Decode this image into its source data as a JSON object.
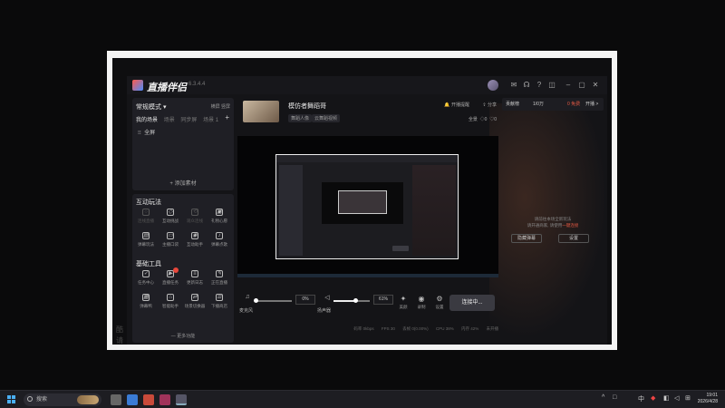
{
  "app": {
    "title": "直播伴侣",
    "version": "6.3.4.4"
  },
  "titlebar_icons": [
    "message-icon",
    "headset-icon",
    "help-icon",
    "skin-icon",
    "minimize-icon",
    "maximize-icon",
    "close-icon"
  ],
  "left": {
    "mode_label": "常规模式 ▾",
    "mode_links": [
      "横屏",
      "竖屏"
    ],
    "scene_tabs": [
      "我的场景",
      "场景",
      "同步屏",
      "场景 1"
    ],
    "scene_item": "全屏",
    "add_source": "+ 添加素材",
    "interactive_title": "互动玩法",
    "interactive_tools": [
      "连线直播",
      "互动挑战",
      "观众连线",
      "礼物心愿",
      "弹幕玩法",
      "主播口袋",
      "互动助手",
      "弹幕点歌"
    ],
    "basic_title": "基础工具",
    "basic_tools": [
      "任务中心",
      "直播任务",
      "更新日志",
      "正在直播",
      "弹幕鸭",
      "智能助手",
      "场景切换器",
      "下播商店"
    ],
    "more": "— 更多功能"
  },
  "center": {
    "room_title": "模仿者舞蹈哥",
    "tags": [
      "舞蹈人像",
      "云舞蹈视频"
    ],
    "actions": [
      "开播提醒",
      "分享"
    ],
    "stats": [
      "全景",
      "0",
      "0"
    ],
    "mic_label": "麦克风",
    "mic_pct": "0%",
    "speaker_label": "扬声器",
    "speaker_pct": "61%",
    "mic_level": 0.0,
    "speaker_level": 0.61,
    "icons": [
      "美颜",
      "录制",
      "设置"
    ],
    "go_live": "连接中...",
    "status": [
      "码率 0kbps",
      "FPS 30",
      "丢帧 0(0.00%)",
      "CPU 38%",
      "内存 42%",
      "未开播"
    ]
  },
  "right": {
    "head_left": "贡献榜",
    "head_mid": "1/0万",
    "head_red": "0 免费",
    "head_right": "开播 >",
    "tip_line1": "请前往本场全新玩法",
    "tip_line2": "请开通商家, 请使用",
    "tip_link": "一键连接",
    "btn_left": "隐藏弹幕",
    "btn_right": "设置"
  },
  "ghost_text": [
    "酷",
    "请"
  ],
  "taskbar": {
    "search_placeholder": "搜索",
    "tray_symbols": [
      "^",
      "□",
      "中",
      "◧",
      "⊞"
    ],
    "time": "19:01",
    "date": "2026/4/28"
  }
}
